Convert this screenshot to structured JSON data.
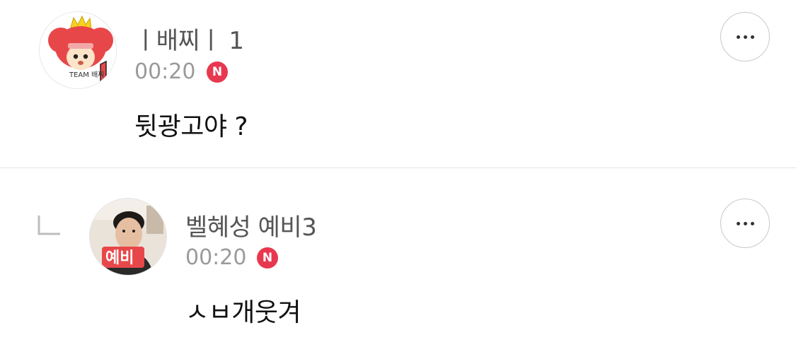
{
  "comments": [
    {
      "author": "ㅣ배찌ㅣ 1",
      "time": "00:20",
      "badge": "N",
      "text": "뒷광고야 ?",
      "avatar_icon": "team-baejji-character-avatar",
      "avatar_text": "TEAM 배찌"
    },
    {
      "author": "벨혜성 예비3",
      "time": "00:20",
      "badge": "N",
      "text": "ㅅㅂ개웃겨",
      "avatar_icon": "profile-photo-avatar",
      "avatar_text": "예비",
      "is_reply": true
    }
  ],
  "colors": {
    "badge": "#e8384f",
    "meta": "#9a9a9a",
    "divider": "#e2e2e2"
  }
}
